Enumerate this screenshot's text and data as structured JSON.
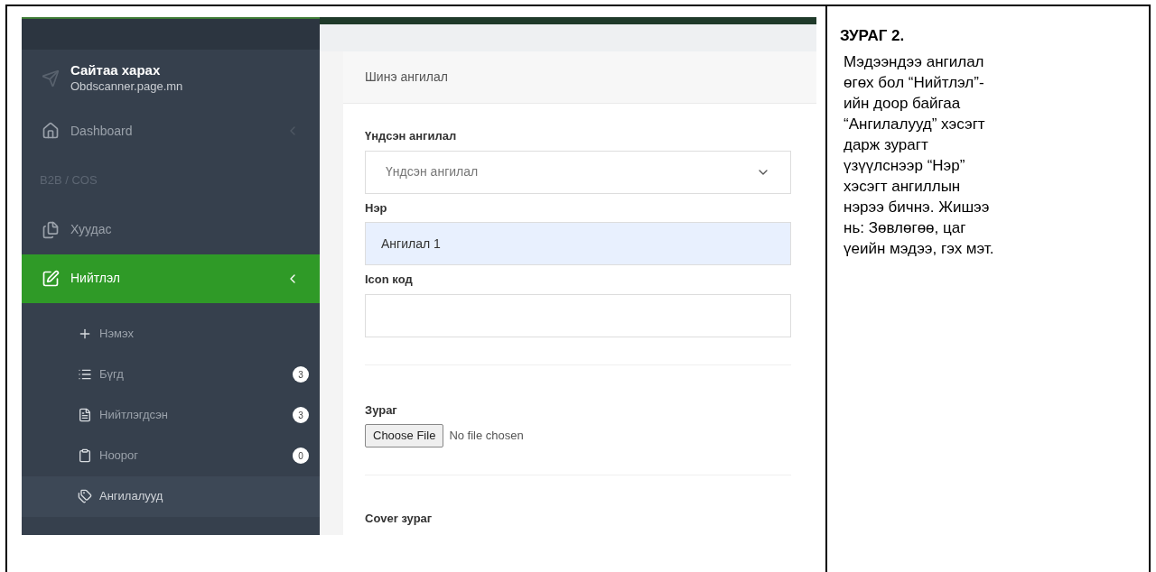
{
  "screenshot": {
    "sidebar": {
      "site": {
        "title": "Сайтаа харах",
        "url": "Obdscanner.page.mn"
      },
      "items": [
        {
          "kind": "link",
          "label": "Dashboard",
          "selected": false,
          "expanded": false
        },
        {
          "kind": "section",
          "label": "B2B / COS"
        },
        {
          "kind": "link",
          "label": "Хуудас",
          "selected": false
        },
        {
          "kind": "link",
          "label": "Нийтлэл",
          "selected": true,
          "expanded": true,
          "children": [
            {
              "label": "Нэмэх",
              "selected": false
            },
            {
              "label": "Бүгд",
              "count": "3",
              "selected": false
            },
            {
              "label": "Нийтлэгдсэн",
              "count": "3",
              "selected": false
            },
            {
              "label": "Ноорог",
              "count": "0",
              "selected": false
            },
            {
              "label": "Ангилалууд",
              "selected": true
            }
          ]
        }
      ]
    },
    "form": {
      "title": "Шинэ ангилал",
      "fields": [
        {
          "kind": "select",
          "label": "Үндсэн ангилал",
          "value": "Үндсэн ангилал"
        },
        {
          "kind": "text",
          "label": "Нэр",
          "value": "Ангилал 1",
          "autofilled": true
        },
        {
          "kind": "text",
          "label": "Icon код"
        },
        {
          "kind": "file",
          "label": "Зураг",
          "button": "Choose File",
          "status": "No file chosen"
        },
        {
          "kind": "heading",
          "label": "Cover зураг"
        }
      ]
    }
  },
  "caption": {
    "title": "ЗУРАГ 2.",
    "text": "Мэдээндээ ангилал өгөх бол “Нийтлэл”-ийн доор байгаа “Ангилалууд” хэсэгт дарж зурагт үзүүлснээр “Нэр” хэсэгт ангиллын нэрээ бичнэ. Жишээ нь: Зөвлөгөө, цаг үеийн мэдээ, гэх мэт."
  }
}
